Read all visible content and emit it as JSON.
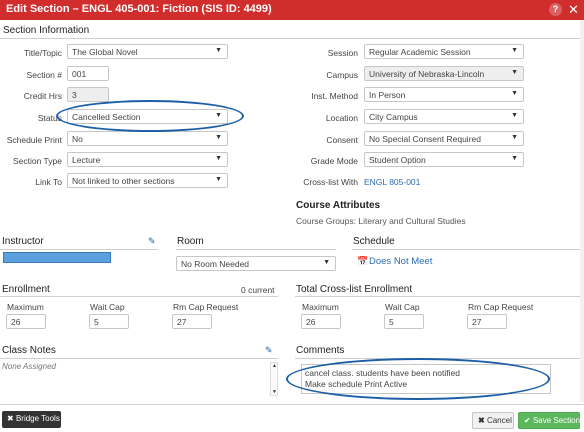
{
  "window": {
    "title": "Edit Section – ENGL 405-001: Fiction (SIS ID: 4499)"
  },
  "section_info": {
    "heading": "Section Information",
    "title_topic": {
      "label": "Title/Topic",
      "value": "The Global Novel"
    },
    "section_num": {
      "label": "Section #",
      "value": "001"
    },
    "credit_hrs": {
      "label": "Credit Hrs",
      "value": "3"
    },
    "status": {
      "label": "Status",
      "value": "Cancelled Section"
    },
    "schedule_print": {
      "label": "Schedule Print",
      "value": "No"
    },
    "section_type": {
      "label": "Section Type",
      "value": "Lecture"
    },
    "link_to": {
      "label": "Link To",
      "value": "Not linked to other sections"
    },
    "session": {
      "label": "Session",
      "value": "Regular Academic Session"
    },
    "campus": {
      "label": "Campus",
      "value": "University of Nebraska-Lincoln"
    },
    "inst_method": {
      "label": "Inst. Method",
      "value": "In Person"
    },
    "location": {
      "label": "Location",
      "value": "City Campus"
    },
    "consent": {
      "label": "Consent",
      "value": "No Special Consent Required"
    },
    "grade_mode": {
      "label": "Grade Mode",
      "value": "Student Option"
    },
    "crosslist": {
      "label": "Cross-list With",
      "value": "ENGL 805-001"
    }
  },
  "course_attributes": {
    "heading": "Course Attributes",
    "text": "Course Groups: Literary and Cultural Studies"
  },
  "instructor": {
    "heading": "Instructor"
  },
  "room": {
    "heading": "Room",
    "value": "No Room Needed"
  },
  "schedule": {
    "heading": "Schedule",
    "value": "Does Not Meet"
  },
  "enrollment": {
    "heading": "Enrollment",
    "current": "0 current",
    "max_label": "Maximum",
    "max": "26",
    "wait_label": "Wait Cap",
    "wait": "5",
    "rm_label": "Rm Cap Request",
    "rm": "27"
  },
  "total_crosslist": {
    "heading": "Total Cross-list Enrollment",
    "max_label": "Maximum",
    "max": "26",
    "wait_label": "Wait Cap",
    "wait": "5",
    "rm_label": "Rm Cap Request",
    "rm": "27"
  },
  "class_notes": {
    "heading": "Class Notes",
    "value": "None Assigned"
  },
  "comments": {
    "heading": "Comments",
    "line1": "cancel class. students have been notified",
    "line2": "Make schedule Print Active"
  },
  "buttons": {
    "bridge": "Bridge Tools",
    "cancel": "Cancel",
    "save": "Save Section"
  },
  "colors": {
    "titlebar": "#d12d2d",
    "annotation": "#1c5fa8",
    "link": "#2a6db0",
    "save": "#5cb85c"
  }
}
